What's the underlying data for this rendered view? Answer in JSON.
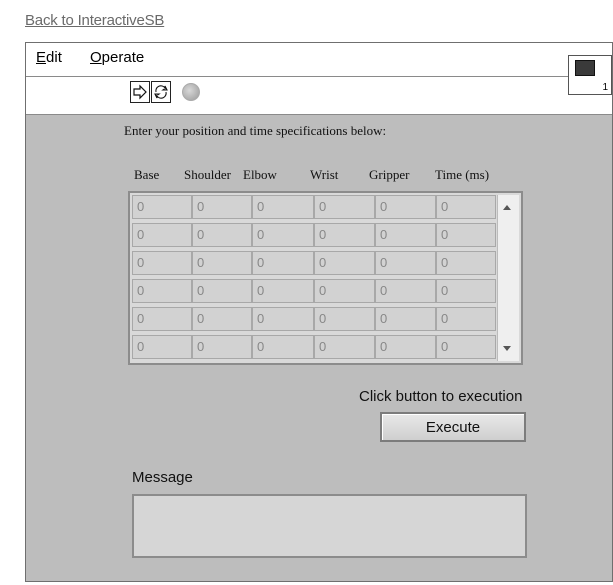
{
  "back_link": "Back to InteractiveSB",
  "menu": {
    "edit": "Edit",
    "operate": "Operate"
  },
  "vi_icon_number": "1",
  "instructions": "Enter your position and time specifications below:",
  "columns": [
    "Base",
    "Shoulder",
    "Elbow",
    "Wrist",
    "Gripper",
    "Time (ms)"
  ],
  "rows": [
    [
      "0",
      "0",
      "0",
      "0",
      "0",
      "0"
    ],
    [
      "0",
      "0",
      "0",
      "0",
      "0",
      "0"
    ],
    [
      "0",
      "0",
      "0",
      "0",
      "0",
      "0"
    ],
    [
      "0",
      "0",
      "0",
      "0",
      "0",
      "0"
    ],
    [
      "0",
      "0",
      "0",
      "0",
      "0",
      "0"
    ],
    [
      "0",
      "0",
      "0",
      "0",
      "0",
      "0"
    ]
  ],
  "execute_prompt": "Click button to execution",
  "execute_label": "Execute",
  "message_label": "Message",
  "message_value": ""
}
